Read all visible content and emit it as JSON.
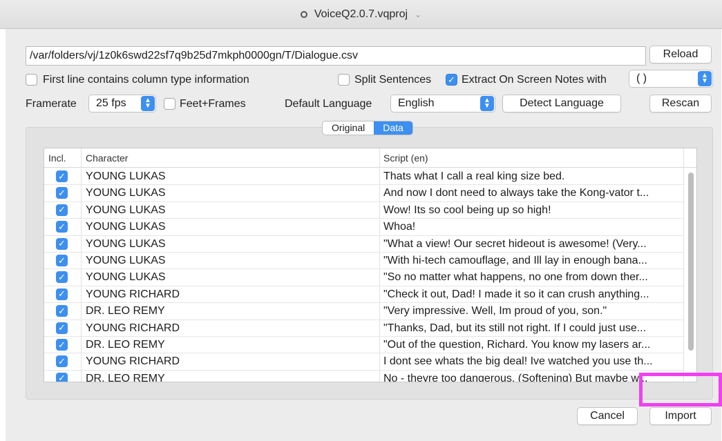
{
  "window": {
    "title": "VoiceQ2.0.7.vqproj"
  },
  "file": {
    "path": "/var/folders/vj/1z0k6swd22sf7q9b25d7mkph0000gn/T/Dialogue.csv",
    "reload_label": "Reload"
  },
  "options": {
    "first_line_label": "First line contains column type information",
    "first_line_checked": false,
    "split_sentences_label": "Split Sentences",
    "split_sentences_checked": false,
    "extract_notes_label": "Extract On Screen Notes with",
    "extract_notes_checked": true,
    "notes_delimiter": "( )",
    "framerate_label": "Framerate",
    "framerate_value": "25 fps",
    "feet_frames_label": "Feet+Frames",
    "feet_frames_checked": false,
    "default_language_label": "Default Language",
    "default_language_value": "English",
    "detect_language_label": "Detect Language",
    "rescan_label": "Rescan"
  },
  "view_tabs": {
    "original": "Original",
    "data": "Data",
    "selected": "Data"
  },
  "table": {
    "columns": [
      "Incl.",
      "Character",
      "Script (en)"
    ],
    "rows": [
      {
        "incl": true,
        "character": "YOUNG LUKAS",
        "script": "Thats what I call a real king size bed."
      },
      {
        "incl": true,
        "character": "YOUNG LUKAS",
        "script": "And now I dont need to always take the Kong-vator t..."
      },
      {
        "incl": true,
        "character": "YOUNG LUKAS",
        "script": "Wow! Its so cool being up so high!"
      },
      {
        "incl": true,
        "character": "YOUNG LUKAS",
        "script": "Whoa!"
      },
      {
        "incl": true,
        "character": "YOUNG LUKAS",
        "script": "\"What a view! Our secret hideout is awesome! (Very..."
      },
      {
        "incl": true,
        "character": "YOUNG LUKAS",
        "script": "\"With hi-tech camouflage, and Ill lay in enough bana..."
      },
      {
        "incl": true,
        "character": "YOUNG LUKAS",
        "script": "\"So no matter what happens, no one from down ther..."
      },
      {
        "incl": true,
        "character": "YOUNG RICHARD",
        "script": "\"Check it out, Dad! I made it so it can crush anything..."
      },
      {
        "incl": true,
        "character": "DR. LEO REMY",
        "script": "\"Very impressive. Well, Im proud of you, son.\""
      },
      {
        "incl": true,
        "character": "YOUNG RICHARD",
        "script": "\"Thanks, Dad, but its still not right. If I could just use..."
      },
      {
        "incl": true,
        "character": "DR. LEO REMY",
        "script": "\"Out of the question, Richard. You know my lasers ar..."
      },
      {
        "incl": true,
        "character": "YOUNG RICHARD",
        "script": "I dont see whats the big deal! Ive watched you use th..."
      },
      {
        "incl": true,
        "character": "DR. LEO REMY",
        "script": "No - theyre too dangerous. (Softening) But maybe w..."
      }
    ]
  },
  "footer": {
    "cancel_label": "Cancel",
    "import_label": "Import"
  },
  "colors": {
    "accent": "#3d8ff0",
    "highlight": "#f040f0"
  }
}
